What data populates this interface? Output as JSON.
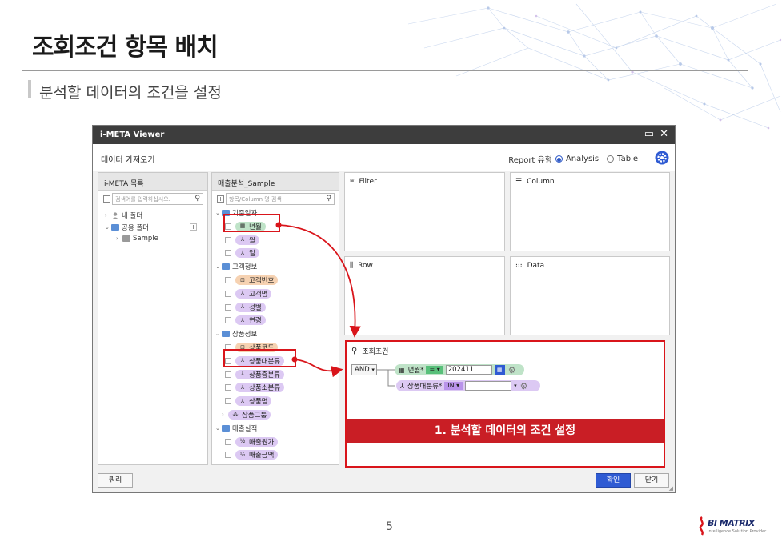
{
  "slide": {
    "title": "조회조건 항목 배치",
    "subtitle": "분석할 데이터의 조건을 설정",
    "page_number": "5",
    "brand": "BI MATRIX",
    "brand_tagline": "Intelligence Solution Provider"
  },
  "window": {
    "title": "i-META Viewer",
    "header_title": "데이터 가져오기",
    "report_type_label": "Report 유형",
    "report_options": [
      "Analysis",
      "Table"
    ],
    "report_selected": "Analysis"
  },
  "meta_panel": {
    "title": "i-META 목록",
    "search_placeholder": "검색어를 입력하십시오.",
    "tree": [
      {
        "label": "내 폴더"
      },
      {
        "label": "공용 폴더"
      },
      {
        "label": "Sample"
      }
    ]
  },
  "field_panel": {
    "title": "매출분석_Sample",
    "search_placeholder": "항목/Column 명 검색",
    "groups": [
      {
        "label": "기준일자",
        "items": [
          "년월",
          "월",
          "일"
        ]
      },
      {
        "label": "고객정보",
        "items": [
          "고객번호",
          "고객명",
          "성별",
          "연령"
        ]
      },
      {
        "label": "상품정보",
        "items": [
          "상품코드",
          "상품대분류",
          "상품중분류",
          "상품소분류",
          "상품명",
          "상품그룹"
        ]
      },
      {
        "label": "매출실적",
        "items": [
          "매출원가",
          "매출금액"
        ]
      }
    ]
  },
  "zones": {
    "filter": "Filter",
    "column": "Column",
    "row": "Row",
    "data": "Data"
  },
  "condition": {
    "title": "조회조건",
    "logic": "AND",
    "rows": [
      {
        "field": "년월*",
        "operator": "=",
        "value": "202411"
      },
      {
        "field": "상품대분류*",
        "operator": "IN",
        "value": ""
      }
    ],
    "banner": "1. 분석할 데이터의 조건 설정"
  },
  "buttons": {
    "query": "쿼리",
    "confirm": "확인",
    "close": "닫기"
  },
  "colors": {
    "highlight_red": "#d9151b",
    "banner_red": "#c91e25",
    "primary_blue": "#2f5bd3",
    "chip_green": "#bfe3c8",
    "chip_purple": "#dcc9f3",
    "chip_orange": "#f6d2b2"
  }
}
